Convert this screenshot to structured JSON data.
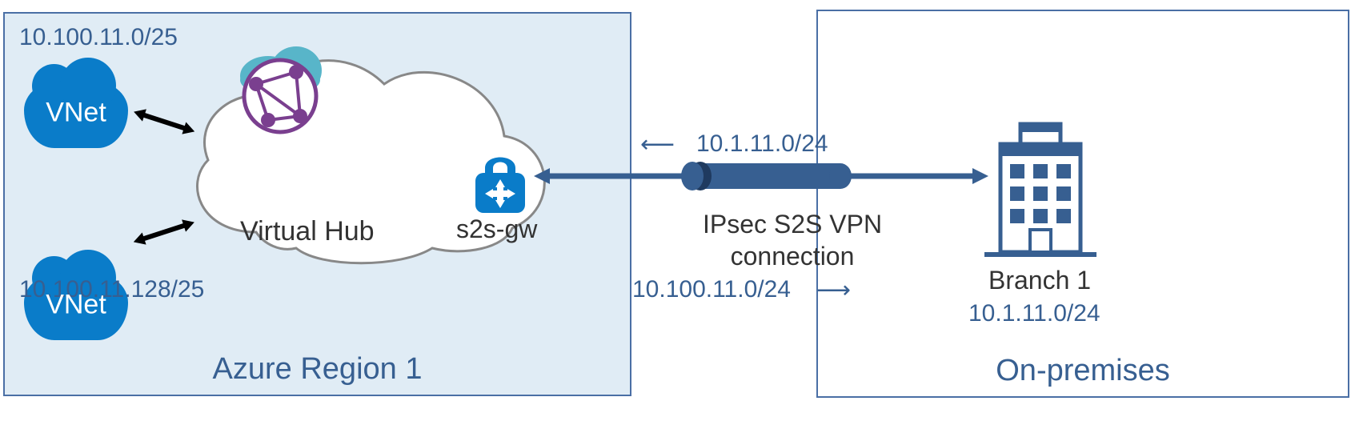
{
  "azure": {
    "region_label": "Azure Region 1",
    "hub_label": "Virtual Hub",
    "gateway_label": "s2s-gw",
    "vnets": [
      {
        "label": "VNet",
        "cidr": "10.100.11.0/25"
      },
      {
        "label": "VNet",
        "cidr": "10.100.11.128/25"
      }
    ]
  },
  "onprem": {
    "region_label": "On-premises",
    "branch_label": "Branch 1",
    "branch_cidr": "10.1.11.0/24"
  },
  "connection": {
    "type_label": "IPsec S2S VPN connection",
    "advertised_to_azure": "10.1.11.0/24",
    "advertised_to_onprem": "10.100.11.0/24"
  },
  "colors": {
    "accent_blue": "#375f91",
    "vnet_blue": "#0a7cc9",
    "region_bg": "#e0ecf5"
  }
}
